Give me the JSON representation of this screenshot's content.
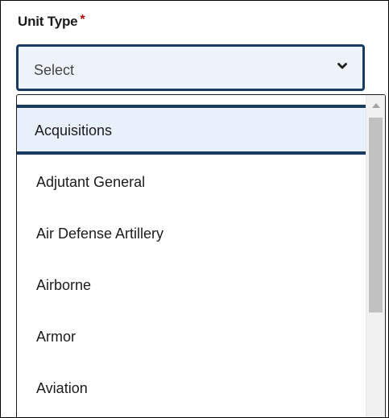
{
  "field": {
    "label": "Unit Type",
    "required_marker": "*"
  },
  "select": {
    "value": "Select",
    "icon": "chevron-down-icon",
    "expanded": true
  },
  "dropdown": {
    "focused_option": "Acquisitions",
    "options": [
      "Acquisitions",
      "Adjutant General",
      "Air Defense Artillery",
      "Airborne",
      "Armor",
      "Aviation"
    ]
  },
  "colors": {
    "focus_border": "#1a3a60",
    "focused_option_bg": "#e8f0fb",
    "select_bg": "#eef3fb",
    "required": "#b50909",
    "text": "#1b1b1b",
    "scrollbar_thumb": "#c1c1c1"
  }
}
